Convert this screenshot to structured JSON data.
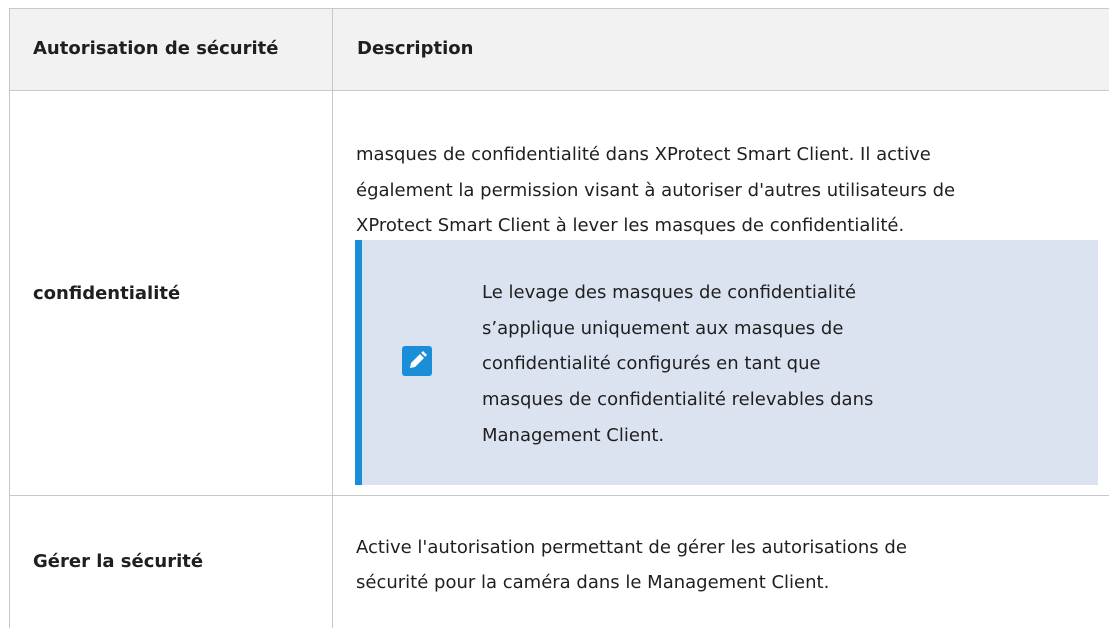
{
  "table": {
    "headers": [
      "Autorisation de sécurité",
      "Description"
    ],
    "rows": [
      {
        "title": "confidentialité",
        "description_lines": [
          "masques de confidentialité dans XProtect Smart Client. Il active",
          "également la permission visant à autoriser d'autres utilisateurs de",
          "XProtect Smart Client à lever les masques de confidentialité."
        ],
        "note": {
          "icon": "pencil-note-icon",
          "lines": [
            "Le levage des masques de confidentialité",
            "s’applique uniquement aux masques de",
            "confidentialité configurés en tant que",
            "masques de confidentialité relevables dans",
            "Management Client."
          ]
        }
      },
      {
        "title": "Gérer la sécurité",
        "description_lines": [
          "Active l'autorisation permettant de gérer les autorisations de",
          "sécurité pour la caméra dans le Management Client."
        ]
      }
    ]
  },
  "colors": {
    "note_background": "#dbe3f1",
    "note_accent": "#1a8ed8",
    "header_background": "#f2f2f2",
    "border": "#c8c8c8"
  }
}
